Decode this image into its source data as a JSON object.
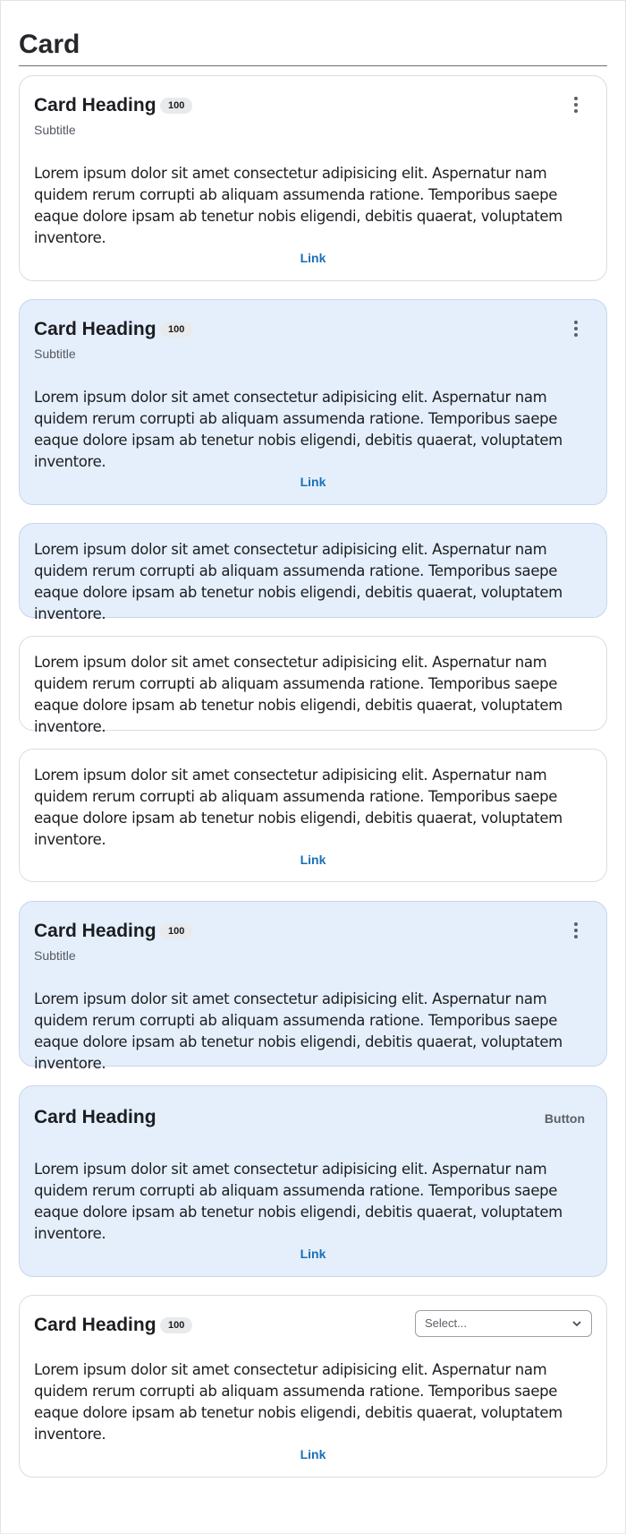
{
  "page": {
    "title": "Card"
  },
  "cards": [
    {
      "heading": "Card Heading",
      "badge": "100",
      "subtitle": "Subtitle",
      "body": "Lorem ipsum dolor sit amet consectetur adipisicing elit. Aspernatur nam quidem rerum corrupti ab aliquam assumenda ratione. Temporibus saepe eaque dolore ipsam ab tenetur nobis eligendi, debitis quaerat, voluptatem inventore.",
      "link": "Link"
    },
    {
      "heading": "Card Heading",
      "badge": "100",
      "subtitle": "Subtitle",
      "body": "Lorem ipsum dolor sit amet consectetur adipisicing elit. Aspernatur nam quidem rerum corrupti ab aliquam assumenda ratione. Temporibus saepe eaque dolore ipsam ab tenetur nobis eligendi, debitis quaerat, voluptatem inventore.",
      "link": "Link"
    },
    {
      "body": "Lorem ipsum dolor sit amet consectetur adipisicing elit. Aspernatur nam quidem rerum corrupti ab aliquam assumenda ratione. Temporibus saepe eaque dolore ipsam ab tenetur nobis eligendi, debitis quaerat, voluptatem inventore."
    },
    {
      "body": "Lorem ipsum dolor sit amet consectetur adipisicing elit. Aspernatur nam quidem rerum corrupti ab aliquam assumenda ratione. Temporibus saepe eaque dolore ipsam ab tenetur nobis eligendi, debitis quaerat, voluptatem inventore."
    },
    {
      "body": "Lorem ipsum dolor sit amet consectetur adipisicing elit. Aspernatur nam quidem rerum corrupti ab aliquam assumenda ratione. Temporibus saepe eaque dolore ipsam ab tenetur nobis eligendi, debitis quaerat, voluptatem inventore.",
      "link": "Link"
    },
    {
      "heading": "Card Heading",
      "badge": "100",
      "subtitle": "Subtitle",
      "body": "Lorem ipsum dolor sit amet consectetur adipisicing elit. Aspernatur nam quidem rerum corrupti ab aliquam assumenda ratione. Temporibus saepe eaque dolore ipsam ab tenetur nobis eligendi, debitis quaerat, voluptatem inventore."
    },
    {
      "heading": "Card Heading",
      "button": "Button",
      "body": "Lorem ipsum dolor sit amet consectetur adipisicing elit. Aspernatur nam quidem rerum corrupti ab aliquam assumenda ratione. Temporibus saepe eaque dolore ipsam ab tenetur nobis eligendi, debitis quaerat, voluptatem inventore.",
      "link": "Link"
    },
    {
      "heading": "Card Heading",
      "badge": "100",
      "select_placeholder": "Select...",
      "body": "Lorem ipsum dolor sit amet consectetur adipisicing elit. Aspernatur nam quidem rerum corrupti ab aliquam assumenda ratione. Temporibus saepe eaque dolore ipsam ab tenetur nobis eligendi, debitis quaerat, voluptatem inventore.",
      "link": "Link"
    }
  ],
  "colors": {
    "tint": "#e5effb",
    "link": "#1a6fb6",
    "border": "#dadde2"
  },
  "icons": {
    "menu": "more-vertical-icon",
    "select": "chevron-down-icon"
  }
}
